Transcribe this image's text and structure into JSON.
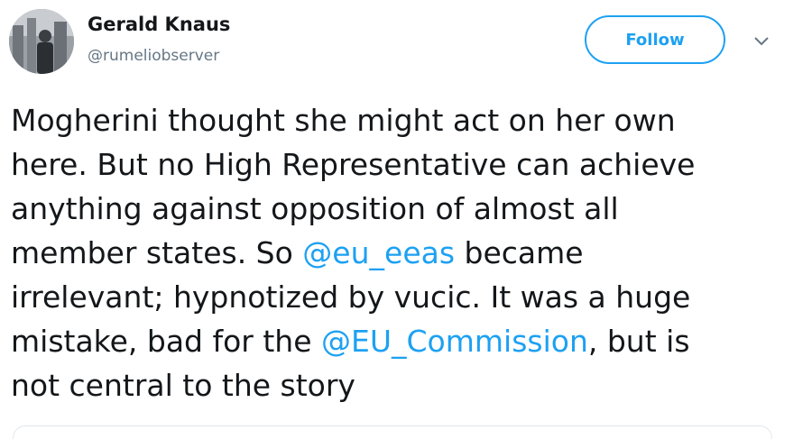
{
  "author": {
    "display_name": "Gerald Knaus",
    "handle": "@rumeliobserver"
  },
  "actions": {
    "follow_label": "Follow",
    "more_icon": "chevron-down-icon"
  },
  "tweet": {
    "line1": "Mogherini thought she might act on her own",
    "line2": "here. But no High Representative can achieve",
    "line3": "anything against opposition of almost all",
    "line4_pre": "member states. So ",
    "mention_1": "@eu_eeas",
    "line4_post": " became",
    "line5": "irrelevant; hypnotized by vucic. It was a huge",
    "line6_pre": "mistake, bad for the ",
    "mention_2": "@EU_Commission",
    "line6_post": ", but is",
    "line7": "not central to the story"
  },
  "colors": {
    "accent": "#1da1f2",
    "text": "#14171a",
    "secondary_text": "#657786",
    "border": "#e1e8ed"
  }
}
